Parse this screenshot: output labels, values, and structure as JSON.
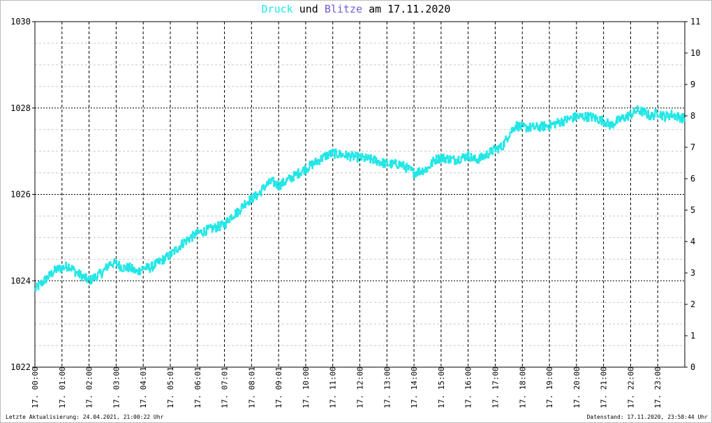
{
  "title": {
    "series1": "Druck",
    "conj": "und",
    "series2": "Blitze",
    "date_prefix": "am",
    "date": "17.11.2020"
  },
  "footer": {
    "left": "Letzte Aktualisierung: 24.04.2021, 21:00:22 Uhr",
    "right": "Datenstand: 17.11.2020, 23:58:44 Uhr"
  },
  "colors": {
    "druck": "#22e6e6",
    "blitze": "#6e5cd6",
    "grid_major": "#000000",
    "grid_minor": "#c8c8c8"
  },
  "chart_data": {
    "type": "line",
    "title": "Druck und Blitze am 17.11.2020",
    "x_tick_labels": [
      "17. 00:00",
      "17. 01:00",
      "17. 02:00",
      "17. 03:00",
      "17. 04:01",
      "17. 05:01",
      "17. 06:01",
      "17. 07:01",
      "17. 08:01",
      "17. 09:01",
      "17. 10:00",
      "17. 11:00",
      "17. 12:00",
      "17. 13:00",
      "17. 14:00",
      "17. 15:00",
      "17. 16:00",
      "17. 17:00",
      "17. 18:00",
      "17. 19:00",
      "17. 20:00",
      "17. 21:00",
      "17. 22:00",
      "17. 23:00"
    ],
    "xlim_hours": [
      0,
      24
    ],
    "y_left": {
      "ylim": [
        1022,
        1030
      ],
      "ticks": [
        "1022",
        "1024",
        "1026",
        "1028",
        "1030"
      ]
    },
    "y_right": {
      "ylim": [
        0,
        11
      ],
      "ticks": [
        "0",
        "1",
        "2",
        "3",
        "4",
        "5",
        "6",
        "7",
        "8",
        "9",
        "10",
        "11"
      ]
    },
    "grid": true,
    "series": [
      {
        "name": "Druck",
        "axis": "left",
        "x_hours": [
          0,
          0.25,
          0.5,
          0.75,
          1.0,
          1.25,
          1.5,
          1.75,
          2.0,
          2.25,
          2.5,
          2.75,
          3.0,
          3.25,
          3.5,
          3.75,
          4.0,
          4.25,
          4.5,
          4.75,
          5.0,
          5.5,
          6.0,
          6.5,
          7.0,
          7.25,
          7.5,
          7.75,
          8.0,
          8.25,
          8.5,
          8.75,
          9.0,
          9.25,
          9.5,
          9.75,
          10.0,
          10.25,
          10.5,
          10.75,
          11.0,
          11.5,
          12.0,
          12.5,
          13.0,
          13.5,
          14.0,
          14.25,
          14.5,
          14.75,
          15.0,
          15.5,
          16.0,
          16.25,
          16.5,
          17.0,
          17.25,
          17.5,
          17.75,
          18.0,
          18.5,
          19.0,
          19.5,
          20.0,
          20.5,
          21.0,
          21.25,
          21.5,
          22.0,
          22.25,
          22.5,
          22.75,
          23.0,
          23.25,
          23.5,
          23.75,
          24.0
        ],
        "values": [
          1023.8,
          1023.95,
          1024.1,
          1024.25,
          1024.3,
          1024.35,
          1024.2,
          1024.1,
          1024.0,
          1024.1,
          1024.2,
          1024.4,
          1024.4,
          1024.3,
          1024.3,
          1024.2,
          1024.3,
          1024.3,
          1024.4,
          1024.5,
          1024.6,
          1024.9,
          1025.1,
          1025.2,
          1025.3,
          1025.5,
          1025.6,
          1025.8,
          1025.9,
          1026.0,
          1026.2,
          1026.3,
          1026.2,
          1026.3,
          1026.4,
          1026.5,
          1026.6,
          1026.7,
          1026.8,
          1026.9,
          1026.95,
          1026.9,
          1026.85,
          1026.8,
          1026.7,
          1026.7,
          1026.5,
          1026.55,
          1026.6,
          1026.8,
          1026.85,
          1026.8,
          1026.9,
          1026.8,
          1026.85,
          1027.05,
          1027.1,
          1027.4,
          1027.6,
          1027.55,
          1027.55,
          1027.6,
          1027.7,
          1027.8,
          1027.8,
          1027.7,
          1027.6,
          1027.7,
          1027.85,
          1027.95,
          1027.9,
          1027.8,
          1027.9,
          1027.8,
          1027.85,
          1027.8,
          1027.75
        ]
      }
    ]
  }
}
